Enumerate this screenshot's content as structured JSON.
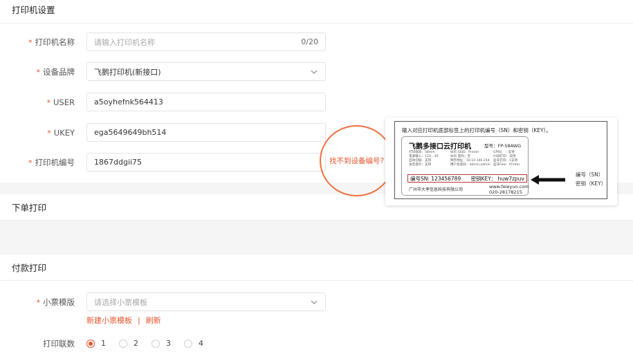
{
  "sections": {
    "printer_settings": "打印机设置",
    "order_print": "下单打印",
    "payment_print": "付款打印"
  },
  "form": {
    "required_mark": "*",
    "printer_name": {
      "label": "打印机名称",
      "placeholder": "请输入打印机名称",
      "counter": "0/20"
    },
    "brand": {
      "label": "设备品牌",
      "value": "飞鹅打印机(新接口)"
    },
    "user": {
      "label": "USER",
      "value": "a5oyhefnk564413"
    },
    "ukey": {
      "label": "UKEY",
      "value": "ega5649649bh514"
    },
    "printer_sn": {
      "label": "打印机编号",
      "value": "1867ddgii75"
    },
    "not_found_hint": "找不到设备编号?"
  },
  "label_image": {
    "caption": "输入对应打印机底部标签上的打印机编号（SN）和密钥（KEY）。",
    "title": "飞鹅多接口云打印机",
    "model": "型号：FP-58AWG",
    "specs": [
      "打印纸宽：58mm",
      "WiFi SSID：Printer",
      "GPRS　：支持",
      "电源输入：12V，3A",
      "WiFi 密码：无",
      "USB打印：支持",
      "自动切纸：支持",
      "网页地址：10.10.100.254",
      "蓝牙打印：1支持",
      "语音提示：支持",
      "用户名密码：admin,admin",
      "蓝牙Feie：Printer"
    ],
    "sn": "编号SN:  123456789",
    "key": "密钥KEY：  huw7zpuv",
    "company": "广州市大孝信息科技有限公司",
    "website": "www.feieyun.com",
    "phone": "020-28178215",
    "side_sn": "编号（SN）",
    "side_key": "密钥（KEY）"
  },
  "payment": {
    "template": {
      "label": "小票模版",
      "placeholder": "请选择小票模板"
    },
    "new_template": "新建小票模板",
    "separator": "|",
    "refresh": "刷新",
    "copies": {
      "label": "打印联数",
      "options": [
        "1",
        "2",
        "3",
        "4"
      ],
      "selected": "1"
    }
  },
  "colors": {
    "accent": "#e8552c",
    "circle": "#ef7040",
    "background": "#f5f5f5"
  },
  "icons": {
    "select_arrow": "chevron-down-icon",
    "pointer": "arrow-left-icon"
  }
}
